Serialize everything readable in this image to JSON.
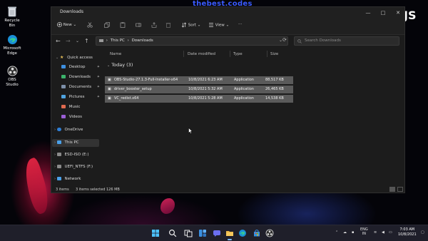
{
  "watermark": "thebest.codes",
  "logo_text": "JS",
  "desktop": {
    "icons": [
      {
        "label": "Recycle Bin",
        "icon": "recycle-bin-icon"
      },
      {
        "label": "Microsoft Edge",
        "icon": "edge-icon"
      },
      {
        "label": "OBS Studio",
        "icon": "obs-icon"
      }
    ]
  },
  "window": {
    "title": "Downloads",
    "controls": {
      "minimize": "—",
      "maximize": "□",
      "close": "✕"
    },
    "toolbar": {
      "new_label": "New",
      "sort_label": "Sort",
      "view_label": "View",
      "more_label": "···"
    },
    "address": {
      "root": "This PC",
      "sep": "›",
      "current": "Downloads"
    },
    "search_placeholder": "Search Downloads",
    "sidebar": {
      "quick_access": "Quick access",
      "items": [
        {
          "label": "Desktop",
          "pinned": true
        },
        {
          "label": "Downloads",
          "pinned": true
        },
        {
          "label": "Documents",
          "pinned": true
        },
        {
          "label": "Pictures",
          "pinned": true
        },
        {
          "label": "Music",
          "pinned": false
        },
        {
          "label": "Videos",
          "pinned": false
        }
      ],
      "onedrive": "OneDrive",
      "this_pc": "This PC",
      "esd": "ESD-ISO (E:)",
      "uefi": "UEFI_NTFS (F:)",
      "network": "Network"
    },
    "columns": {
      "name": "Name",
      "date": "Date modified",
      "type": "Type",
      "size": "Size"
    },
    "group_label": "Today (3)",
    "files": [
      {
        "name": "OBS-Studio-27.1.3-Full-Installer-x64",
        "date": "10/8/2021 6:23 AM",
        "type": "Application",
        "size": "88,517 KB"
      },
      {
        "name": "driver_booster_setup",
        "date": "10/8/2021 5:32 AM",
        "type": "Application",
        "size": "26,465 KB"
      },
      {
        "name": "VC_redist.x64",
        "date": "10/8/2021 5:28 AM",
        "type": "Application",
        "size": "14,538 KB"
      }
    ],
    "status": {
      "items": "3 items",
      "selected": "3 items selected  126 MB"
    }
  },
  "taskbar": {
    "lang": "ENG",
    "region": "IN",
    "time": "7:03 AM",
    "date": "10/8/2021"
  },
  "colors": {
    "selection": "#5a5a5a",
    "accent": "#0078d4",
    "folder": "#e8b64a"
  }
}
